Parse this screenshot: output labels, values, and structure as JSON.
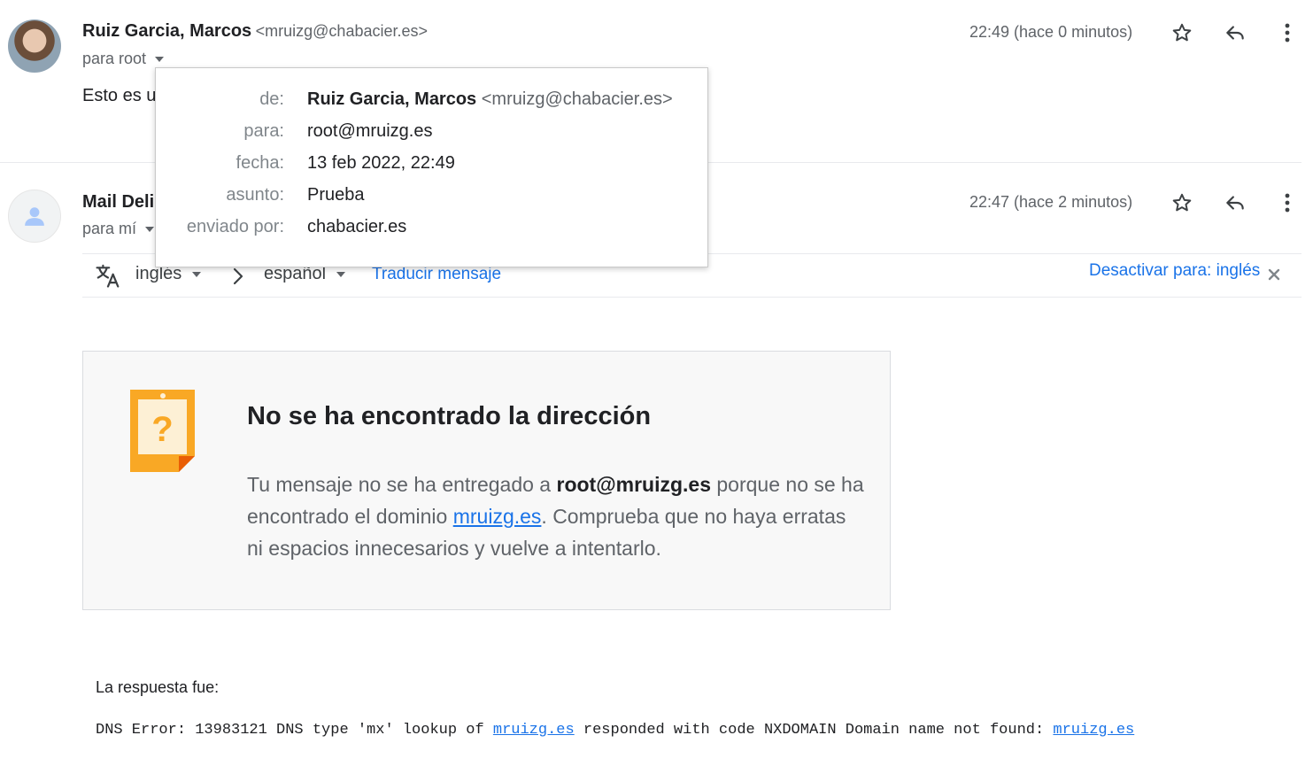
{
  "message1": {
    "sender_name": "Ruiz Garcia, Marcos",
    "sender_email": "<mruizg@chabacier.es>",
    "to_label": "para root",
    "time": "22:49 (hace 0 minutos)",
    "snippet": "Esto es u"
  },
  "message2": {
    "sender_name": "Mail Deli",
    "to_label": "para mí",
    "time": "22:47 (hace 2 minutos)"
  },
  "popup": {
    "from_label": "de:",
    "from_name": "Ruiz Garcia, Marcos",
    "from_email": "<mruizg@chabacier.es>",
    "to_label": "para:",
    "to_value": "root@mruizg.es",
    "date_label": "fecha:",
    "date_value": "13 feb 2022, 22:49",
    "subject_label": "asunto:",
    "subject_value": "Prueba",
    "sent_by_label": "enviado por:",
    "sent_by_value": "chabacier.es"
  },
  "translate": {
    "source_lang": "inglés",
    "target_lang": "español",
    "translate_link": "Traducir mensaje",
    "disable_link": "Desactivar para: inglés"
  },
  "bounce": {
    "title": "No se ha encontrado la dirección",
    "body_1": "Tu mensaje no se ha entregado a ",
    "recipient": "root@mruizg.es",
    "body_2": " porque no se ha encontrado el dominio ",
    "domain": "mruizg.es",
    "body_3": ". Comprueba que no haya erratas ni espacios innecesarios y vuelve a intentarlo."
  },
  "response": {
    "label": "La respuesta fue:",
    "dns_prefix": "DNS Error: 13983121 DNS type 'mx' lookup of ",
    "dns_domain1": "mruizg.es",
    "dns_middle": " responded with code NXDOMAIN Domain name not found: ",
    "dns_domain2": "mruizg.es"
  },
  "colors": {
    "link": "#1a73e8",
    "warning_orange": "#f9a825"
  },
  "icons": [
    "star-icon",
    "reply-icon",
    "more-vert-icon",
    "translate-icon",
    "chevron-right-icon",
    "close-icon",
    "person-icon",
    "question-note-icon"
  ]
}
